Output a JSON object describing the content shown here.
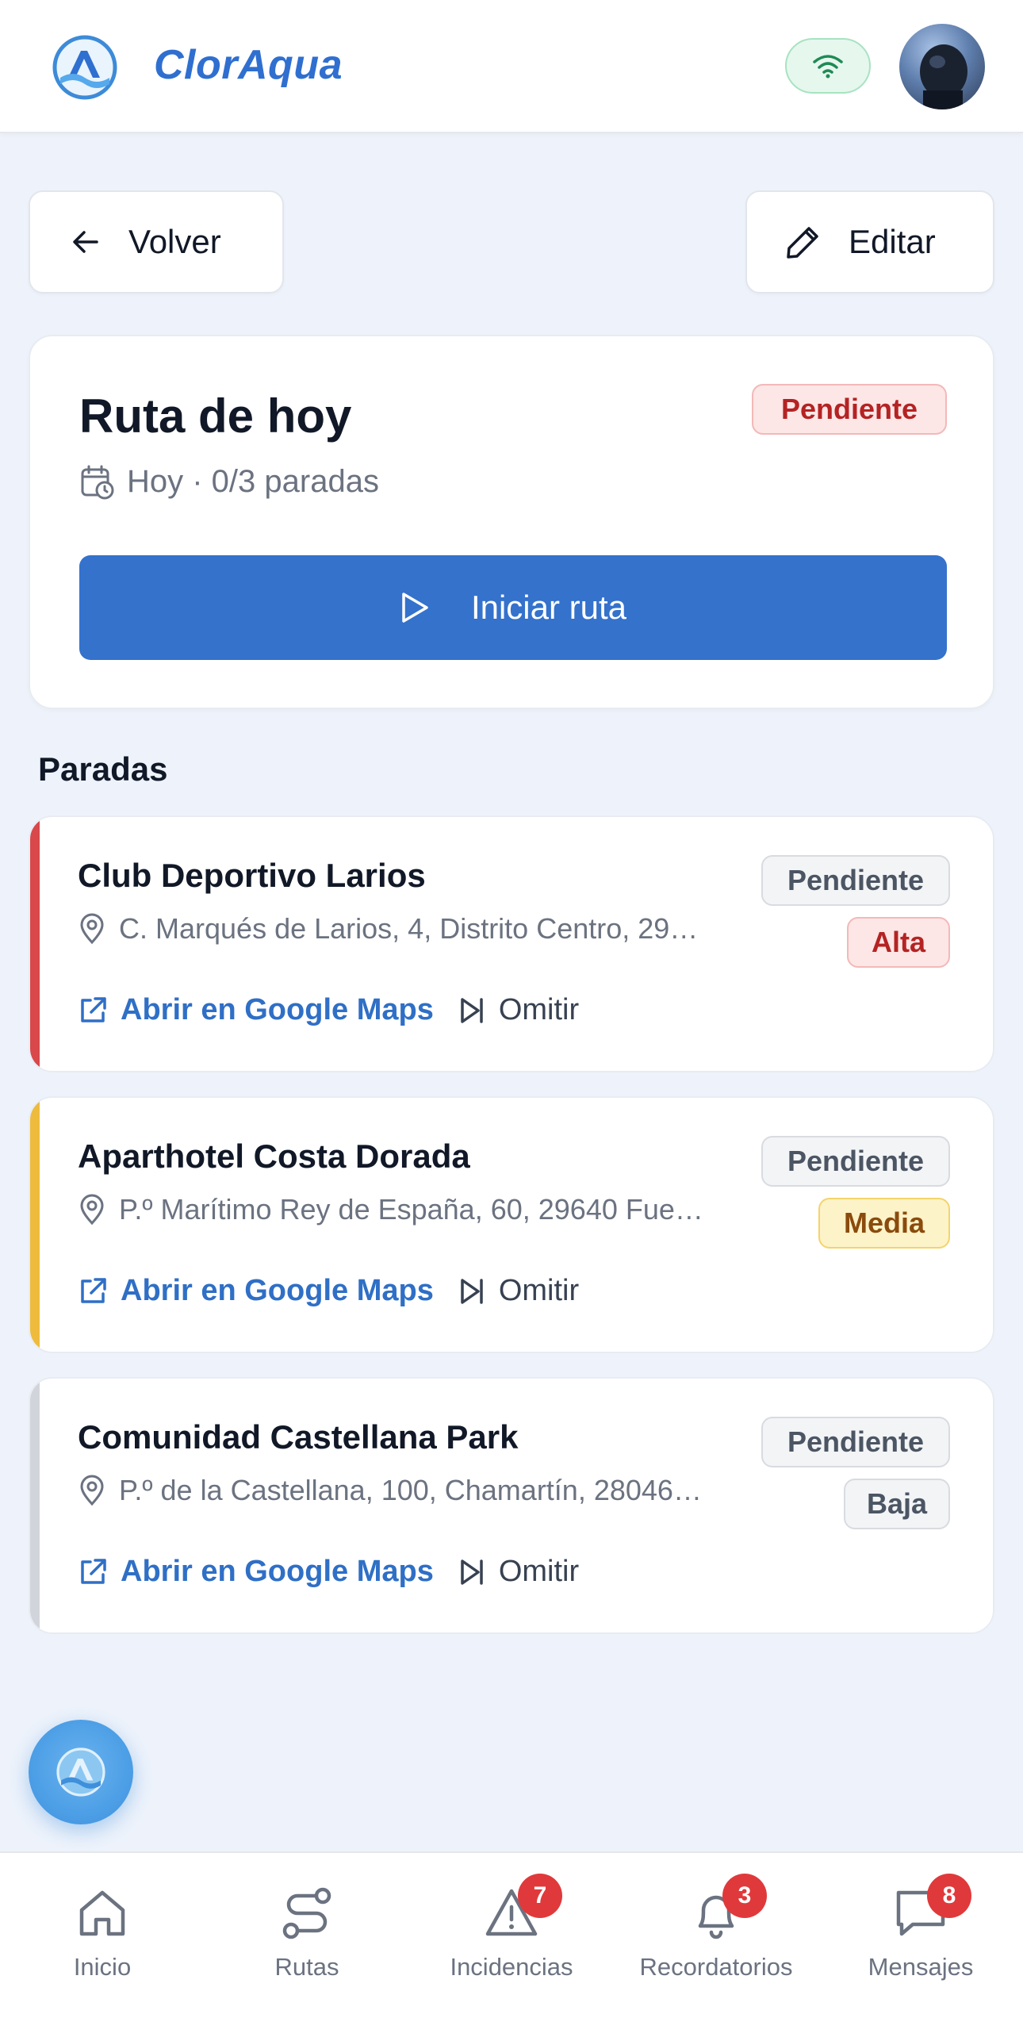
{
  "header": {
    "brand": "ClorAqua",
    "logo_icon": "cloraqua-logo-icon",
    "connection_icon": "wifi-icon",
    "avatar_icon": "user-avatar"
  },
  "toolbar": {
    "back_label": "Volver",
    "edit_label": "Editar"
  },
  "route": {
    "title": "Ruta de hoy",
    "status": "Pendiente",
    "meta": "Hoy · 0/3 paradas",
    "start_label": "Iniciar ruta"
  },
  "stops_section": {
    "title": "Paradas",
    "maps_label": "Abrir en Google Maps",
    "skip_label": "Omitir",
    "items": [
      {
        "name": "Club Deportivo Larios",
        "address": "C. Marqués de Larios, 4, Distrito Centro, 29…",
        "status": "Pendiente",
        "priority": "Alta",
        "accent_color": "#d9484a"
      },
      {
        "name": "Aparthotel Costa Dorada",
        "address": "P.º Marítimo Rey de España, 60, 29640 Fue…",
        "status": "Pendiente",
        "priority": "Media",
        "accent_color": "#eebb3d"
      },
      {
        "name": "Comunidad Castellana Park",
        "address": "P.º de la Castellana, 100, Chamartín, 28046…",
        "status": "Pendiente",
        "priority": "Baja",
        "accent_color": "#d1d5db"
      }
    ]
  },
  "nav": {
    "items": [
      {
        "label": "Inicio",
        "icon": "home-icon"
      },
      {
        "label": "Rutas",
        "icon": "route-icon"
      },
      {
        "label": "Incidencias",
        "icon": "alert-triangle-icon",
        "badge": "7"
      },
      {
        "label": "Recordatorios",
        "icon": "bell-icon",
        "badge": "3"
      },
      {
        "label": "Mensajes",
        "icon": "message-icon",
        "badge": "8"
      }
    ]
  },
  "colors": {
    "brand": "#2f6fd0",
    "primary_button": "#3472cc",
    "background": "#eef3fb",
    "badge_red": "#e0393b"
  }
}
